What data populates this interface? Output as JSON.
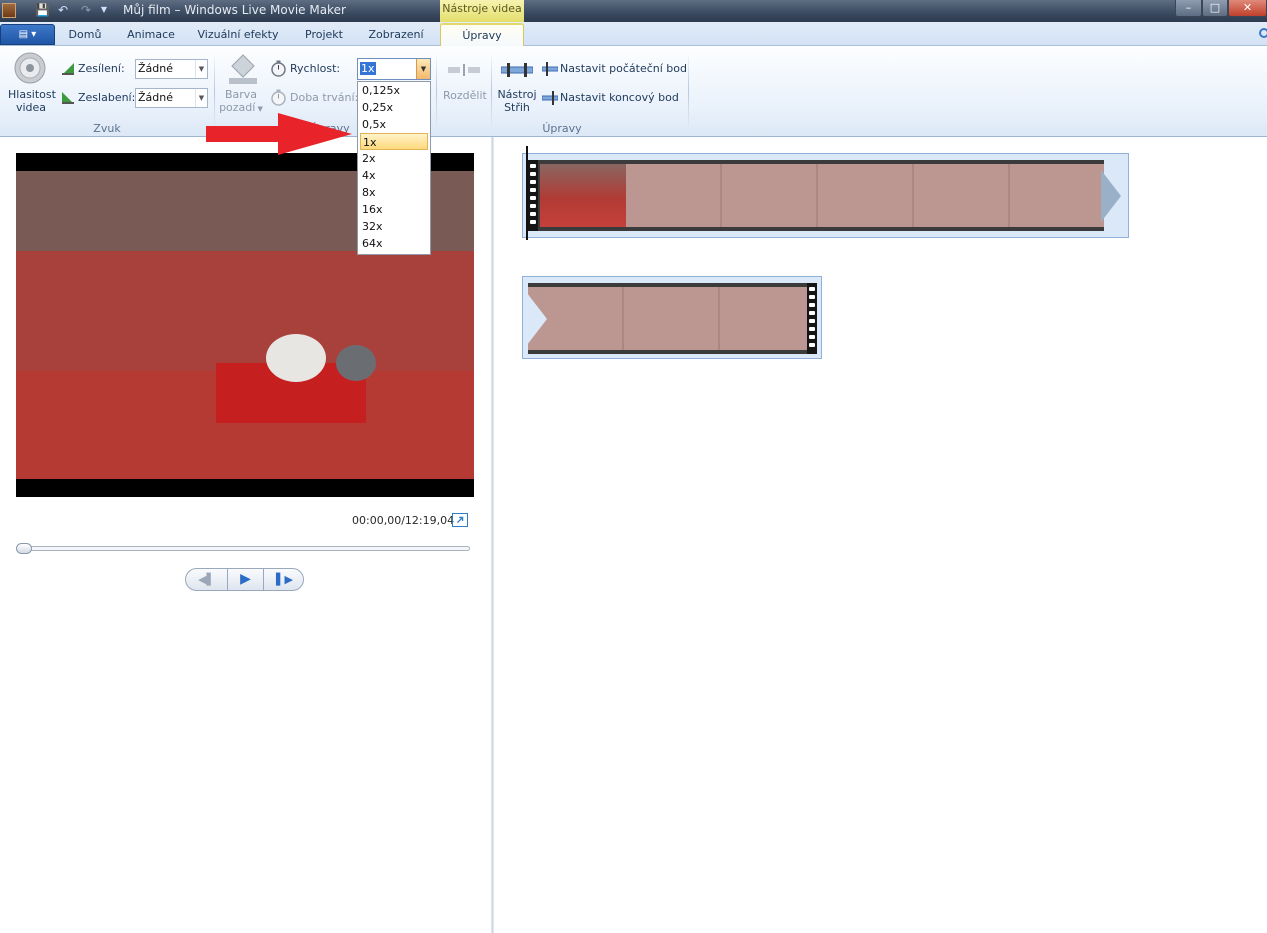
{
  "window": {
    "title": "Můj film – Windows Live Movie Maker",
    "context_tab_group": "Nástroje videa",
    "controls": {
      "minimize": "–",
      "maximize": "□",
      "close": "✕"
    }
  },
  "tabs": [
    {
      "label": "Domů"
    },
    {
      "label": "Animace"
    },
    {
      "label": "Vizuální efekty"
    },
    {
      "label": "Projekt"
    },
    {
      "label": "Zobrazení"
    },
    {
      "label": "Úpravy",
      "active": true
    }
  ],
  "ribbon": {
    "audio_group": {
      "label": "Zvuk",
      "volume_button": {
        "line1": "Hlasitost",
        "line2": "videa"
      },
      "fade_in_label": "Zesílení:",
      "fade_in_value": "Žádné",
      "fade_out_label": "Zeslabení:",
      "fade_out_value": "Žádné"
    },
    "adjust_group": {
      "label": "Úpravy",
      "bg_color": {
        "line1": "Barva",
        "line2": "pozadí"
      },
      "speed_label": "Rychlost:",
      "speed_value": "1x",
      "duration_label": "Doba trvání:"
    },
    "edit_group": {
      "label": "Úpravy",
      "split_label": "Rozdělit",
      "trim_tool": {
        "line1": "Nástroj",
        "line2": "Střih"
      },
      "set_start_label": "Nastavit počáteční bod",
      "set_end_label": "Nastavit koncový bod"
    }
  },
  "speed_options": [
    "0,125x",
    "0,25x",
    "0,5x",
    "1x",
    "2x",
    "4x",
    "8x",
    "16x",
    "32x",
    "64x"
  ],
  "speed_selected": "1x",
  "player": {
    "timecode": "00:00,00/12:19,04",
    "playback_position": 0
  },
  "colors": {
    "accent": "#2b6cc6",
    "annotation_arrow": "#e8232a",
    "context_tab": "#e4de6c"
  },
  "icons": [
    "app-icon",
    "save-icon",
    "undo-icon",
    "redo-icon",
    "qat-dropdown-icon",
    "speaker-icon",
    "fade-in-icon",
    "fade-out-icon",
    "paint-bucket-icon",
    "stopwatch-icon",
    "split-icon",
    "trim-tool-icon",
    "set-start-icon",
    "set-end-icon",
    "fullscreen-icon",
    "previous-frame-icon",
    "play-icon",
    "next-frame-icon",
    "help-icon"
  ]
}
